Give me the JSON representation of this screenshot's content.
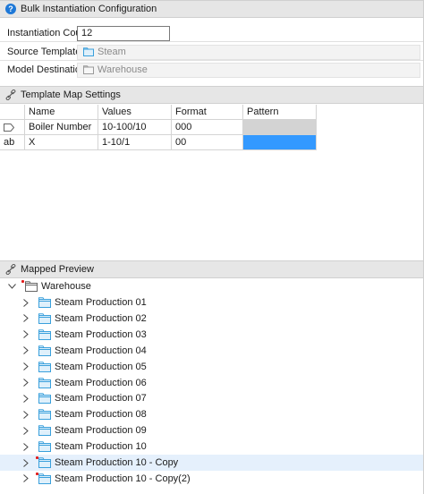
{
  "config_header": {
    "title": "Bulk Instantiation Configuration",
    "icon": "help-icon"
  },
  "properties": {
    "instantiation_count": {
      "label": "Instantiation Count",
      "value": "12"
    },
    "source_template": {
      "label": "Source Template",
      "value": "Steam"
    },
    "model_destination": {
      "label": "Model Destination",
      "value": "Warehouse"
    }
  },
  "map_header": {
    "title": "Template Map Settings",
    "icon": "link-icon"
  },
  "grid": {
    "columns": [
      "Name",
      "Values",
      "Format",
      "Pattern"
    ],
    "rows": [
      {
        "type_icon": "tag-icon",
        "type_text": "",
        "name": "Boiler Number",
        "values": "10-100/10",
        "format": "000",
        "pattern": ""
      },
      {
        "type_icon": "text-type-icon",
        "type_text": "ab",
        "name": "X",
        "values": "1-10/1",
        "format": "00",
        "pattern": ""
      }
    ]
  },
  "preview_header": {
    "title": "Mapped Preview",
    "icon": "link-icon"
  },
  "tree": {
    "root": {
      "label": "Warehouse",
      "expanded": true
    },
    "children": [
      {
        "label": "Steam Production 01",
        "new": false
      },
      {
        "label": "Steam Production 02",
        "new": false
      },
      {
        "label": "Steam Production 03",
        "new": false
      },
      {
        "label": "Steam Production 04",
        "new": false
      },
      {
        "label": "Steam Production 05",
        "new": false
      },
      {
        "label": "Steam Production 06",
        "new": false
      },
      {
        "label": "Steam Production 07",
        "new": false
      },
      {
        "label": "Steam Production 08",
        "new": false
      },
      {
        "label": "Steam Production 09",
        "new": false
      },
      {
        "label": "Steam Production 10",
        "new": false
      },
      {
        "label": "Steam Production 10 - Copy",
        "new": true,
        "selected": true
      },
      {
        "label": "Steam Production 10 - Copy(2)",
        "new": true
      }
    ]
  },
  "colors": {
    "accent": "#1e78d7",
    "pattern_selected": "#3399ff",
    "pattern_disabled": "#d3d3d3",
    "new_marker": "#e21b1b",
    "selection": "#e5f0fc"
  }
}
